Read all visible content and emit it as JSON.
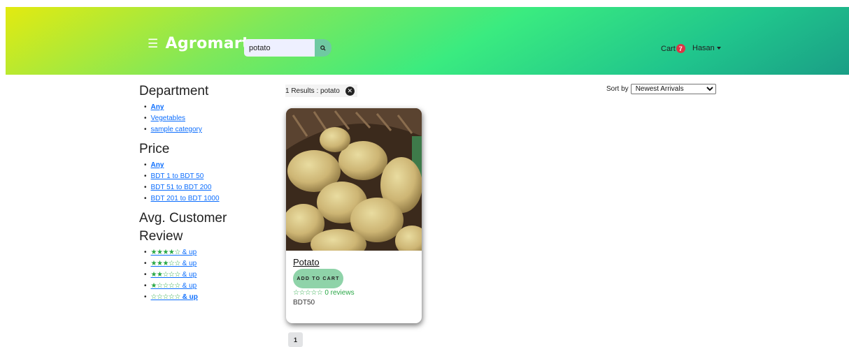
{
  "header": {
    "brand": "Agromart",
    "menu_icon": "hamburger-icon",
    "search": {
      "value": "potato",
      "placeholder": "",
      "icon": "search-icon"
    },
    "cart": {
      "label": "Cart",
      "count": "7"
    },
    "user": {
      "name": "Hasan"
    }
  },
  "sidebar": {
    "department": {
      "title": "Department",
      "items": [
        "Any",
        "Vegetables",
        "sample category"
      ]
    },
    "price": {
      "title": "Price",
      "items": [
        "Any",
        "BDT 1 to BDT 50",
        "BDT 51 to BDT 200",
        "BDT 201 to BDT 1000"
      ]
    },
    "review": {
      "title": "Avg. Customer Review",
      "items": [
        {
          "stars": 4,
          "label": " & up"
        },
        {
          "stars": 3,
          "label": " & up"
        },
        {
          "stars": 2,
          "label": " & up"
        },
        {
          "stars": 1,
          "label": " & up"
        },
        {
          "stars": 0,
          "label": " & up"
        }
      ]
    }
  },
  "results": {
    "text": "1 Results : potato"
  },
  "sort": {
    "label": "Sort by",
    "selected": "Newest Arrivals"
  },
  "product": {
    "name": "Potato",
    "add_to_cart": "ADD TO CART",
    "rating": 0,
    "reviews": "0 reviews",
    "price": "BDT50"
  },
  "pagination": {
    "current": "1"
  },
  "colors": {
    "accent": "#28a745",
    "badge": "#dc3545",
    "button": "#8fd3a9",
    "link": "#0d6efd"
  }
}
